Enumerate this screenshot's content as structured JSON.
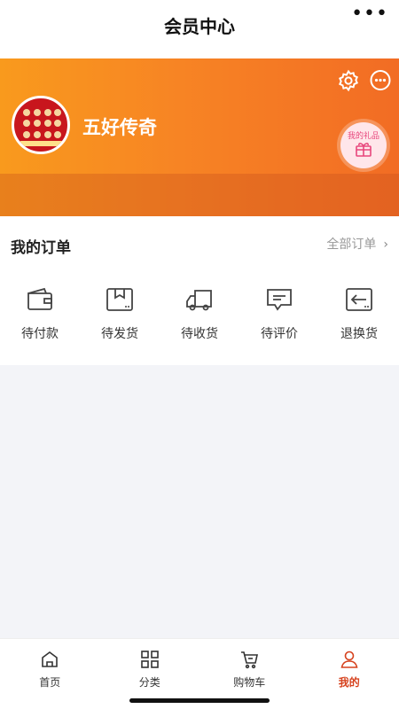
{
  "titlebar": {
    "title": "会员中心",
    "more_icon": "more-dots-icon"
  },
  "profile": {
    "username": "五好传奇",
    "avatar": "store-avatar",
    "settings_icon": "gear-icon",
    "message_icon": "chat-bubble-icon",
    "gift_label": "我的礼品",
    "gift_icon": "gift-icon",
    "colors": {
      "gradient_start": "#f99a1d",
      "gradient_end": "#f26c24"
    }
  },
  "orders": {
    "heading": "我的订单",
    "all_label": "全部订单",
    "items": [
      {
        "label": "待付款",
        "icon": "wallet-icon"
      },
      {
        "label": "待发货",
        "icon": "package-icon"
      },
      {
        "label": "待收货",
        "icon": "truck-icon"
      },
      {
        "label": "待评价",
        "icon": "comment-icon"
      },
      {
        "label": "退换货",
        "icon": "return-icon"
      }
    ]
  },
  "tabbar": {
    "items": [
      {
        "label": "首页",
        "icon": "home-icon",
        "active": false
      },
      {
        "label": "分类",
        "icon": "grid-icon",
        "active": false
      },
      {
        "label": "购物车",
        "icon": "cart-icon",
        "active": false
      },
      {
        "label": "我的",
        "icon": "user-icon",
        "active": true
      }
    ],
    "active_color": "#d6421e"
  }
}
